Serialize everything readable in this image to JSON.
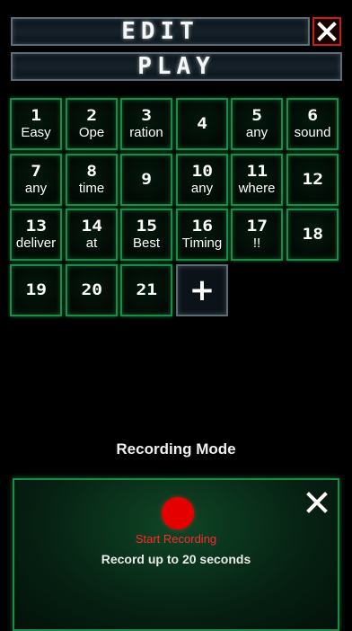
{
  "header": {
    "edit_label": "EDIT",
    "play_label": "PLAY",
    "close_icon": "close-icon"
  },
  "pads": [
    {
      "num": "1",
      "label": "Easy"
    },
    {
      "num": "2",
      "label": "Ope"
    },
    {
      "num": "3",
      "label": "ration"
    },
    {
      "num": "4",
      "label": ""
    },
    {
      "num": "5",
      "label": "any"
    },
    {
      "num": "6",
      "label": "sound"
    },
    {
      "num": "7",
      "label": "any"
    },
    {
      "num": "8",
      "label": "time"
    },
    {
      "num": "9",
      "label": ""
    },
    {
      "num": "10",
      "label": "any"
    },
    {
      "num": "11",
      "label": "where"
    },
    {
      "num": "12",
      "label": ""
    },
    {
      "num": "13",
      "label": "deliver"
    },
    {
      "num": "14",
      "label": "at"
    },
    {
      "num": "15",
      "label": "Best"
    },
    {
      "num": "16",
      "label": "Timing"
    },
    {
      "num": "17",
      "label": "!!"
    },
    {
      "num": "18",
      "label": ""
    },
    {
      "num": "19",
      "label": ""
    },
    {
      "num": "20",
      "label": ""
    },
    {
      "num": "21",
      "label": ""
    }
  ],
  "add_pad": {
    "label": "+",
    "icon": "plus-icon"
  },
  "recording": {
    "mode_title": "Recording Mode",
    "start_label": "Start Recording",
    "hint": "Record up to 20 seconds",
    "button_color": "#e50000",
    "close_icon": "close-icon"
  },
  "colors": {
    "accent_green": "#1f8a47",
    "frame_gray": "#5c6b74",
    "close_red": "#c41d1d",
    "record_red": "#ff2a2a"
  }
}
